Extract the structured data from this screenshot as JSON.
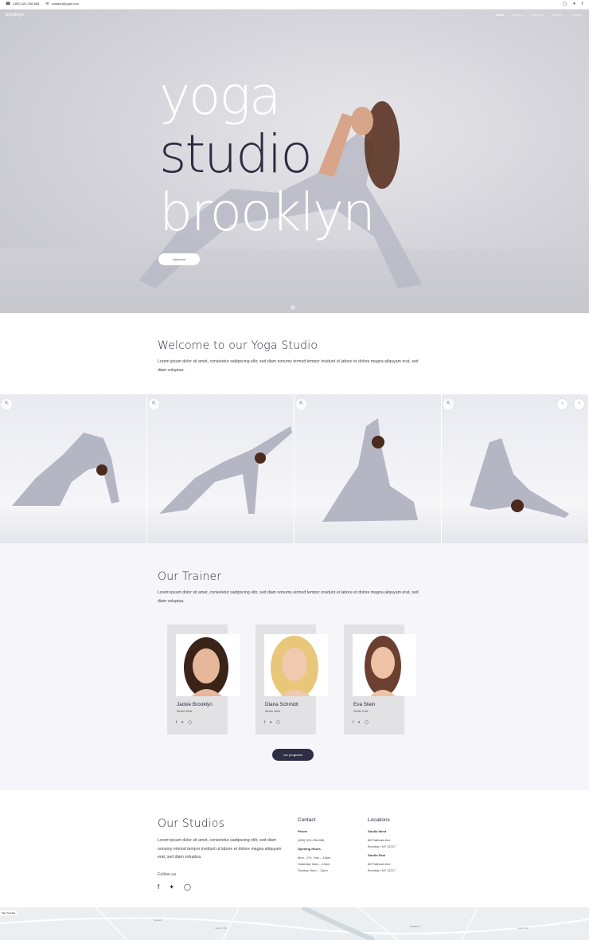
{
  "topbar": {
    "phone": "(450) 523-236-658",
    "email": "contact@yoga.com",
    "social_icons": [
      "instagram-icon",
      "twitter-icon",
      "facebook-icon"
    ]
  },
  "hero": {
    "brand": "brooklyn",
    "nav": [
      "home",
      "studio",
      "programs",
      "gallery",
      "contact"
    ],
    "title_line1": "yoga",
    "title_line2": "studio",
    "title_line3": "brooklyn",
    "button": "welcome"
  },
  "welcome": {
    "heading": "Welcome to our Yoga Studio",
    "text": "Lorem ipsum dolor sit amet, consetetur sadipscing elitr, sed diam nonumy eirmod tempor invidunt ut labore et dolore magna aliquyam erat, sed diam voluptua."
  },
  "trainers": {
    "heading": "Our Trainer",
    "text": "Lorem ipsum dolor sit amet, consetetur sadipscing elitr, sed diam nonumy eirmod tempor invidunt ut labore et dolore magna aliquyam erat, sed diam voluptua.",
    "items": [
      {
        "name": "Jackie Brooklyn",
        "studio": "Studio West"
      },
      {
        "name": "Diana Schmidt",
        "studio": "Studio West"
      },
      {
        "name": "Eva Stein",
        "studio": "Studio East"
      }
    ],
    "button": "our programs"
  },
  "studios": {
    "heading": "Our Studios",
    "text": "Lorem ipsum dolor sit amet, consetetur sadipscing elitr, sed diam nonumy eirmod tempor invidunt ut labore et dolore magna aliquyam erat, sed diam voluptua.",
    "follow": "Follow us"
  },
  "contact": {
    "heading": "Contact",
    "phone_label": "Phone",
    "phone": "(450) 523-236-658",
    "hours_label": "Opening Hours",
    "hours": [
      "Mon – Fri: 7am – 10pm",
      "Saturday: 8am – 10pm",
      "Sunday: 8am – 11pm"
    ]
  },
  "locations": {
    "heading": "Locations",
    "west_label": "Studio West",
    "west": [
      "88 Flatbush Ave",
      "Brooklyn, NY 11217"
    ],
    "east_label": "Studio East",
    "east": [
      "88 Flatbush Ave",
      "Brooklyn, NY 11217"
    ]
  },
  "map": {
    "controls": "Map   Satellite",
    "labels": [
      "Newark",
      "Jersey City",
      "QUEENS",
      "Union City"
    ]
  }
}
